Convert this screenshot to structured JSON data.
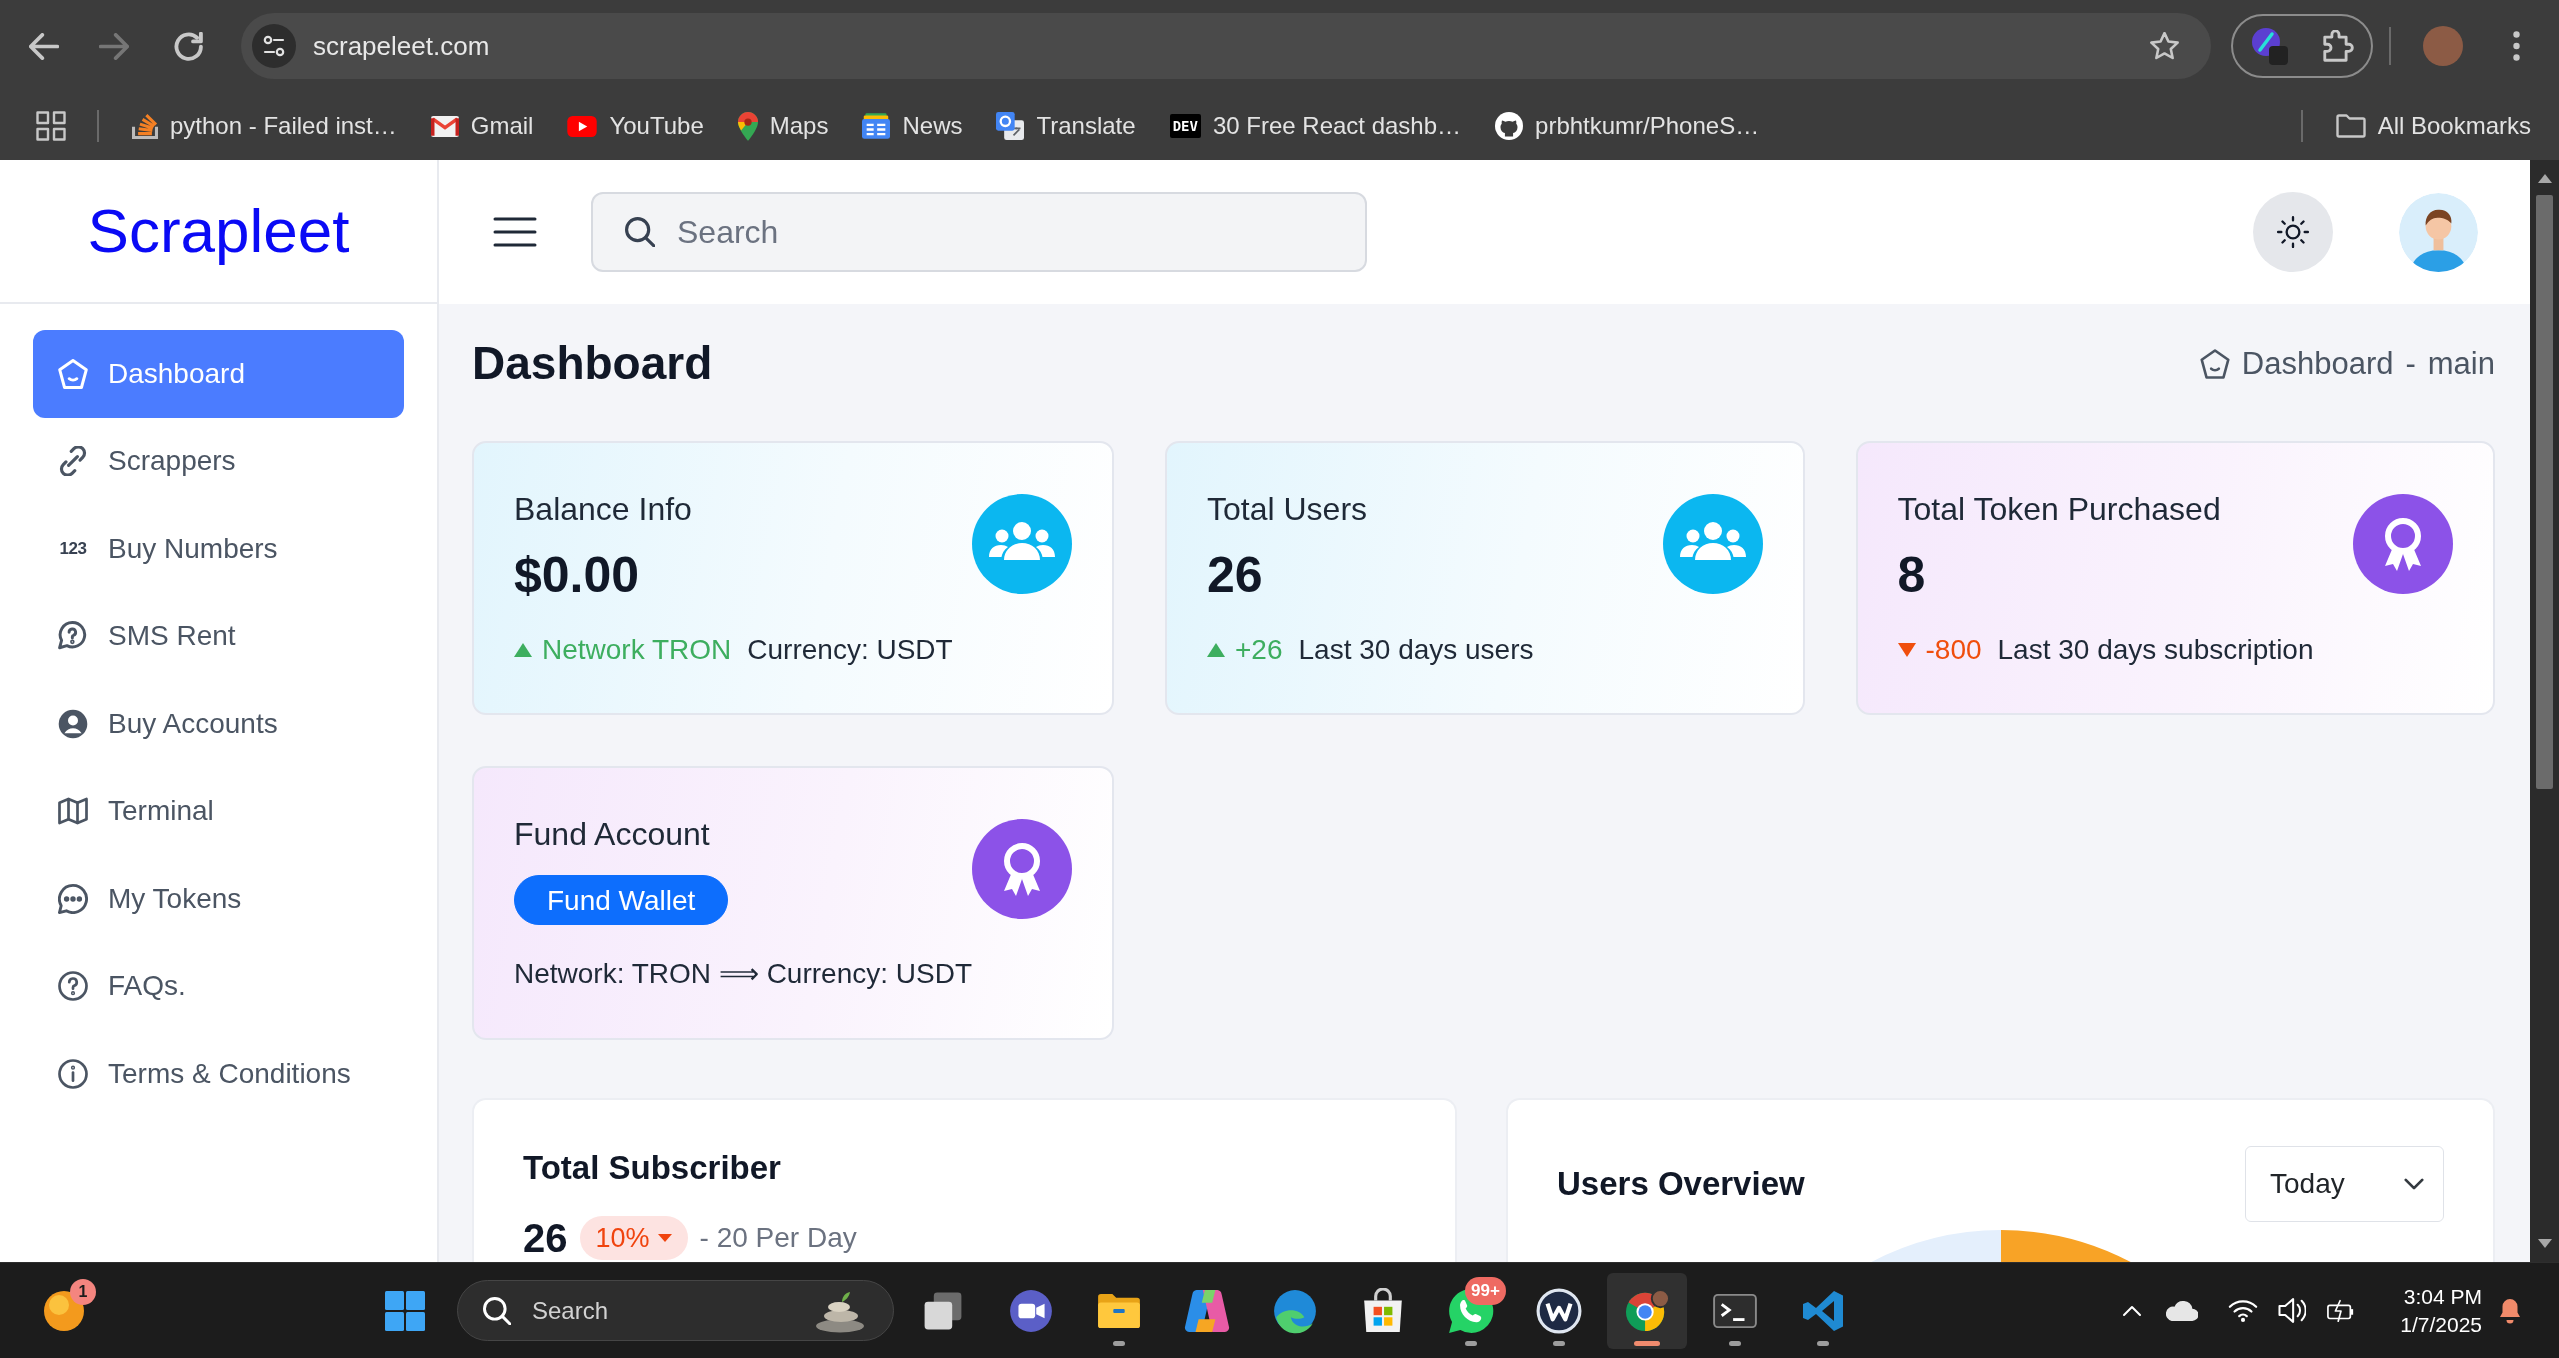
{
  "browser": {
    "nav": [
      {
        "disabled": false
      },
      {
        "disabled": true
      },
      {
        "disabled": false
      }
    ],
    "address": "scrapeleet.com",
    "bookmarks": [
      {
        "label": "python - Failed inst…"
      },
      {
        "label": "Gmail"
      },
      {
        "label": "YouTube"
      },
      {
        "label": "Maps"
      },
      {
        "label": "News"
      },
      {
        "label": "Translate"
      },
      {
        "glyph": "DEV",
        "label": "30 Free React dashb…"
      },
      {
        "label": "prbhtkumr/PhoneS…"
      }
    ],
    "all_bookmarks": "All Bookmarks"
  },
  "app": {
    "logo": "Scrapleet",
    "search": {
      "placeholder": "Search"
    },
    "sidebar": {
      "items": [
        {
          "label": "Dashboard",
          "selected": true
        },
        {
          "label": "Scrappers",
          "selected": false
        },
        {
          "label": "Buy Numbers",
          "glyph": "123",
          "selected": false
        },
        {
          "label": "SMS Rent",
          "selected": false
        },
        {
          "label": "Buy Accounts",
          "selected": false
        },
        {
          "label": "Terminal",
          "selected": false
        },
        {
          "label": "My Tokens",
          "selected": false
        },
        {
          "label": "FAQs.",
          "selected": false
        },
        {
          "label": "Terms & Conditions",
          "selected": false
        }
      ]
    },
    "page_title": "Dashboard",
    "breadcrumb": {
      "items": [
        "Dashboard",
        "main"
      ],
      "separator": "-"
    },
    "cards": [
      {
        "kind": "info",
        "color": "#0bb7f0",
        "title": "Balance Info",
        "value": "$0.00",
        "falling": false,
        "change": "Network TRON",
        "note": "Currency: USDT"
      },
      {
        "kind": "info",
        "color": "#0bb7f0",
        "title": "Total Users",
        "value": "26",
        "falling": false,
        "change": "+26",
        "note": "Last 30 days users"
      },
      {
        "kind": "premium",
        "color": "#8c52e8",
        "title": "Total Token Purchased",
        "value": "8",
        "falling": true,
        "change": "-800",
        "note": "Last 30 days subscription"
      },
      {
        "kind": "premium",
        "color": "#8c52e8",
        "title": "Fund Account",
        "button": "Fund Wallet",
        "note": "Network: TRON ⟹ Currency: USDT"
      }
    ],
    "subscribers": {
      "title": "Total Subscriber",
      "value": "26",
      "falling": true,
      "change": "10%",
      "note": "- 20 Per Day"
    },
    "users_overview": {
      "title": "Users Overview",
      "period": "Today"
    }
  },
  "taskbar": {
    "widget_badge": "1",
    "search": {
      "placeholder": "Search"
    },
    "apps": [
      {
        "running": false,
        "selected": false
      },
      {
        "running": false,
        "selected": false
      },
      {
        "running": true,
        "selected": false
      },
      {
        "running": false,
        "selected": false
      },
      {
        "running": false,
        "selected": false
      },
      {
        "running": false,
        "selected": false
      },
      {
        "running": true,
        "selected": false,
        "badge": "99+"
      },
      {
        "running": true,
        "selected": false
      },
      {
        "running": true,
        "selected": true
      },
      {
        "running": true,
        "selected": false
      },
      {
        "running": true,
        "selected": false
      }
    ],
    "clock": {
      "time": "3:04 PM",
      "date": "1/7/2025"
    }
  }
}
